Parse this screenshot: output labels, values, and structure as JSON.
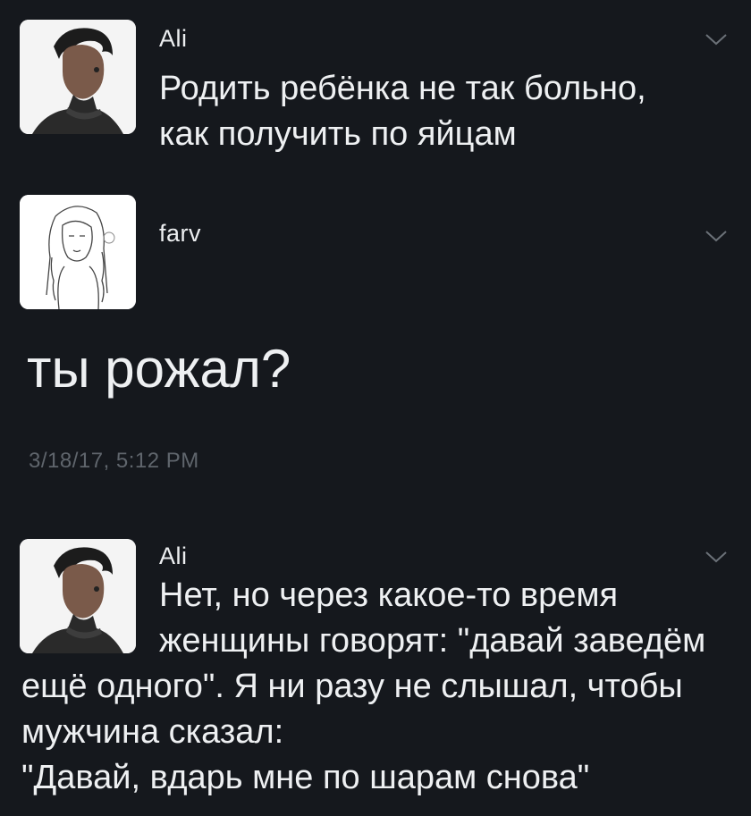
{
  "tweets": [
    {
      "username": "Ali",
      "text": "Родить ребёнка не так больно,\nкак получить по яйцам"
    },
    {
      "username": "farv",
      "text": "ты рожал?",
      "timestamp": "3/18/17, 5:12 PM"
    },
    {
      "username": "Ali",
      "text_line1": "Нет, но через какое-то время",
      "text_line2": "женщины говорят: \"давай заведём",
      "text_rest": "ещё одного\". Я ни разу не слышал, чтобы\nмужчина сказал:\n\"Давай, вдарь мне по шарам снова\""
    }
  ],
  "icons": {
    "chevron": "chevron-down-icon",
    "avatar_ali": "avatar",
    "avatar_farv": "avatar"
  },
  "colors": {
    "background": "#15181d",
    "text": "#eef0f2",
    "timestamp": "#5f656c",
    "chevron": "#6b7178"
  }
}
